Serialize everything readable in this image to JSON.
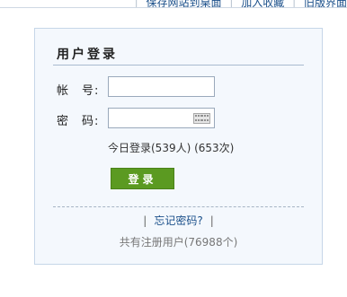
{
  "top_links": [
    "保存网站到桌面",
    "加入收藏",
    "旧版界面"
  ],
  "login": {
    "title": "用户登录",
    "account_label": "帐　号:",
    "password_label": "密　码:",
    "account_value": "",
    "password_value": "",
    "stats_today": "今日登录(539人) (653次)",
    "login_button": "登录",
    "forgot_password": "忘记密码?",
    "separator": "|",
    "registered_users": "共有注册用户(76988个)"
  },
  "icons": {
    "keyboard": "keyboard-icon"
  }
}
